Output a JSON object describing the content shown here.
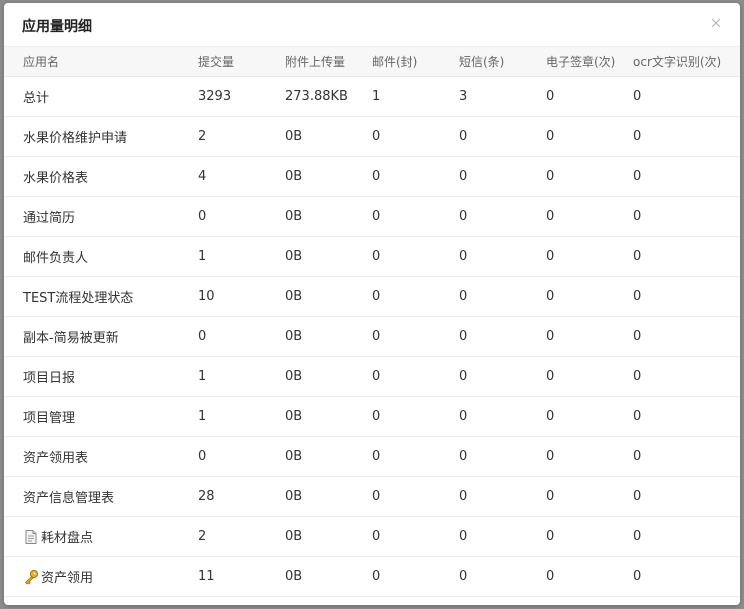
{
  "modal": {
    "title": "应用量明细",
    "close_label": "×"
  },
  "table": {
    "headers": [
      "应用名",
      "提交量",
      "附件上传量",
      "邮件(封)",
      "短信(条)",
      "电子签章(次)",
      "ocr文字识别(次)"
    ],
    "rows": [
      [
        "总计",
        "3293",
        "273.88KB",
        "1",
        "3",
        "0",
        "0"
      ],
      [
        "水果价格维护申请",
        "2",
        "0B",
        "0",
        "0",
        "0",
        "0"
      ],
      [
        "水果价格表",
        "4",
        "0B",
        "0",
        "0",
        "0",
        "0"
      ],
      [
        "通过简历",
        "0",
        "0B",
        "0",
        "0",
        "0",
        "0"
      ],
      [
        "邮件负责人",
        "1",
        "0B",
        "0",
        "0",
        "0",
        "0"
      ],
      [
        "TEST流程处理状态",
        "10",
        "0B",
        "0",
        "0",
        "0",
        "0"
      ],
      [
        "副本-简易被更新",
        "0",
        "0B",
        "0",
        "0",
        "0",
        "0"
      ],
      [
        "项目日报",
        "1",
        "0B",
        "0",
        "0",
        "0",
        "0"
      ],
      [
        "项目管理",
        "1",
        "0B",
        "0",
        "0",
        "0",
        "0"
      ],
      [
        "资产领用表",
        "0",
        "0B",
        "0",
        "0",
        "0",
        "0"
      ],
      [
        "资产信息管理表",
        "28",
        "0B",
        "0",
        "0",
        "0",
        "0"
      ],
      [
        "耗材盘点",
        "2",
        "0B",
        "0",
        "0",
        "0",
        "0"
      ],
      [
        "资产领用",
        "11",
        "0B",
        "0",
        "0",
        "0",
        "0"
      ]
    ],
    "row_icons": {
      "11": "document-icon",
      "12": "key-icon"
    }
  }
}
